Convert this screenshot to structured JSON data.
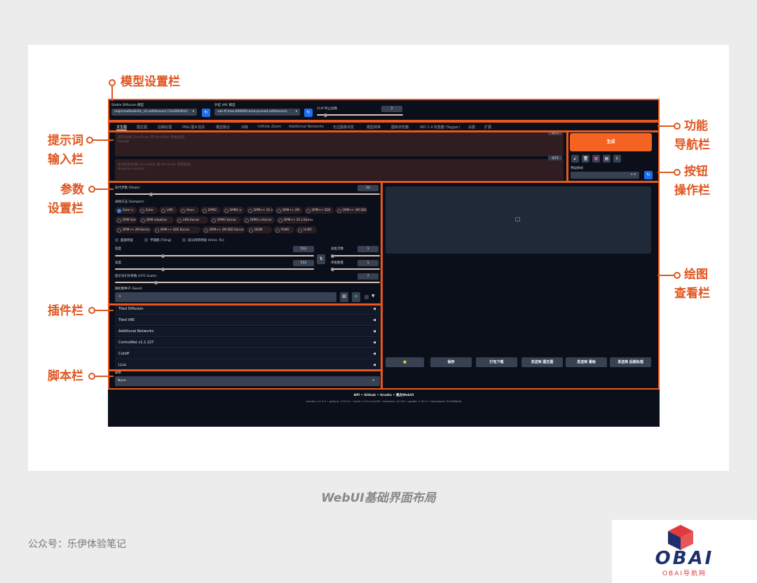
{
  "callouts": {
    "model": "模型设置栏",
    "prompt_1": "提示词",
    "prompt_2": "输入栏",
    "params_1": "参数",
    "params_2": "设置栏",
    "plugins": "插件栏",
    "script": "脚本栏",
    "nav_1": "功能",
    "nav_2": "导航栏",
    "buttons_1": "按钮",
    "buttons_2": "操作栏",
    "gallery_1": "绘图",
    "gallery_2": "查看栏"
  },
  "model_bar": {
    "sd_model_label": "Stable Diffusion 模型",
    "sd_model_value": "majicmixRealistic_v5.safetensors [33c9f6dfcb]",
    "vae_label": "外挂 VAE 模型",
    "vae_value": "vae-ft-mse-840000-ema-pruned.safetensors",
    "clip_label": "CLIP 终止层数",
    "clip_value": "2",
    "refresh_icon": "↻"
  },
  "tabs": [
    "文生图",
    "图生图",
    "后期处理",
    "PNG 图片信息",
    "模型融合",
    "训练",
    "Infinite Zoom",
    "Additional Networks",
    "无边图像浏览",
    "模型转换",
    "图库浏览器",
    "WD 1.4 标签器 (Tagger)",
    "设置",
    "扩展"
  ],
  "prompt": {
    "positive_placeholder": "提示词(按 Ctrl+Enter 或 Alt+Enter 开始生成)",
    "positive_sub": "Prompt",
    "positive_count": "0/75",
    "negative_placeholder": "反向提示词(按 Ctrl+Enter 或 Alt+Enter 开始生成)",
    "negative_sub": "Negative prompt",
    "negative_count": "0/75"
  },
  "actions": {
    "generate": "生成",
    "style_label": "预设样式",
    "style_clear": "× ▾"
  },
  "params": {
    "steps_label": "迭代步数 (Steps)",
    "steps_value": "20",
    "steps_fraction": 0.13,
    "sampler_label": "采样方法 (Sampler)",
    "samplers": [
      "Euler a",
      "Euler",
      "LMS",
      "Heun",
      "DPM2",
      "DPM2 a",
      "DPM++ 2S a",
      "DPM++ 2M",
      "DPM++ SDE",
      "DPM++ 2M SDE",
      "DPM fast",
      "DPM adaptive",
      "LMS Karras",
      "DPM2 Karras",
      "DPM2 a Karras",
      "DPM++ 2S a Karras",
      "DPM++ 2M Karras",
      "DPM++ SDE Karras",
      "DPM++ 2M SDE Karras",
      "DDIM",
      "PLMS",
      "UniPC"
    ],
    "selected_sampler": "Euler a",
    "face_restore": "面部修复",
    "tiling": "平铺图 (Tiling)",
    "hires": "高分辨率修复 (Hires. fix)",
    "width_label": "宽度",
    "width_value": "512",
    "height_label": "高度",
    "height_value": "512",
    "batch_count_label": "总批次数",
    "batch_count_value": "1",
    "batch_size_label": "单批数量",
    "batch_size_value": "1",
    "cfg_label": "提示词引导系数 (CFG Scale)",
    "cfg_value": "7",
    "seed_label": "随机数种子 (Seed)",
    "seed_value": "-1"
  },
  "plugins": [
    "Tiled Diffusion",
    "Tiled VAE",
    "Additional Networks",
    "ControlNet v1.1.227",
    "Cutoff",
    "LLuL"
  ],
  "script": {
    "label": "脚本",
    "value": "None"
  },
  "gallery_buttons": [
    "保存",
    "打包下载",
    "发送到 图生图",
    "发送到 重绘",
    "发送到 后期处理"
  ],
  "footer": {
    "links": "API  •  Github  •  Gradio  •  重启WebUI",
    "version": "version: v1.3.2  •  python: 3.10.11  •  torch: 2.0.0+cu118  •  xformers: 0.0.20  •  gradio: 3.32.0  •  checkpoint: 33c9f6dfcb"
  },
  "caption": "WebUI基础界面布局",
  "credit": "公众号：乐伊体验笔记",
  "logo": {
    "text": "OBAI",
    "sub": "OBAI导航网"
  },
  "colors": {
    "accent": "#e8571e",
    "generate": "#f56322",
    "ui_bg": "#0b0f19",
    "refresh_btn": "#1e6ff0"
  }
}
